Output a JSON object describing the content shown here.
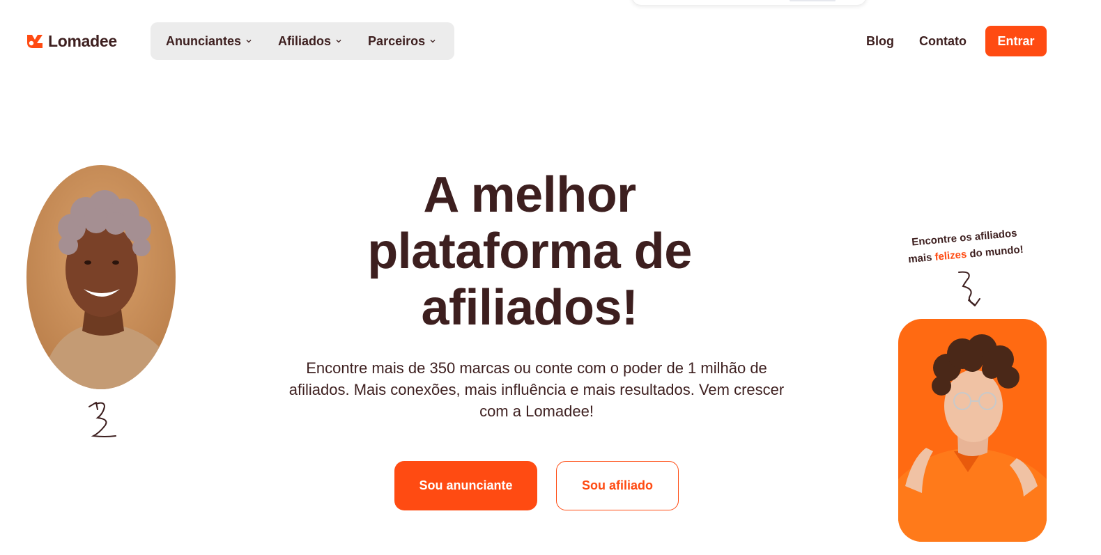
{
  "header": {
    "logo_text": "Lomadee",
    "nav": [
      {
        "label": "Anunciantes"
      },
      {
        "label": "Afiliados"
      },
      {
        "label": "Parceiros"
      }
    ],
    "blog_label": "Blog",
    "contato_label": "Contato",
    "entrar_label": "Entrar"
  },
  "hero": {
    "title_line1": "A melhor",
    "title_line2": "plataforma de",
    "title_line3": "afiliados!",
    "subtitle": "Encontre mais de 350 marcas ou conte com o poder de 1 milhão de afiliados. Mais conexões, mais influência e mais resultados. Vem crescer com a Lomadee!",
    "cta_primary": "Sou anunciante",
    "cta_secondary": "Sou afiliado"
  },
  "tagline": {
    "line1": "Encontre os afiliados",
    "prefix": "mais ",
    "highlight": "felizes",
    "suffix": " do mundo!"
  },
  "colors": {
    "brand": "#ff4b12",
    "text": "#3d1f1f",
    "nav_bg": "#ececec"
  },
  "icons": {
    "logo": "lomadee-logo-icon",
    "chevron": "chevron-down-icon",
    "squiggle": "squiggle-arrow-icon"
  }
}
